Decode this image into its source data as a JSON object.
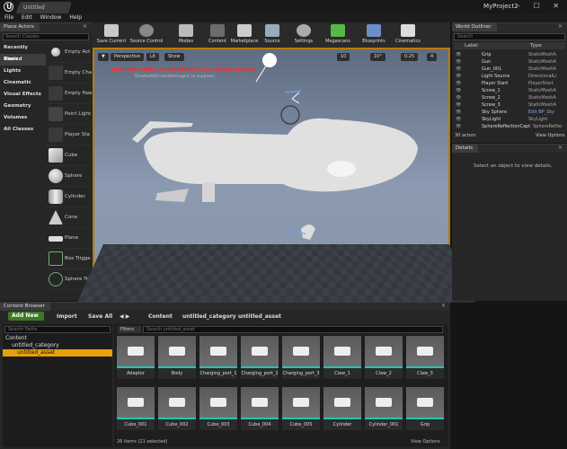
{
  "titlebar": {
    "tab": "Untitled",
    "project": "MyProject2",
    "controls": "– ☐ ✕"
  },
  "menu": [
    "File",
    "Edit",
    "Window",
    "Help"
  ],
  "place_actors": {
    "title": "Place Actors",
    "search_placeholder": "Search Classes",
    "categories": [
      "Recently Placed",
      "Basic",
      "Lights",
      "Cinematic",
      "Visual Effects",
      "Geometry",
      "Volumes",
      "All Classes"
    ],
    "items": [
      "Empty Act",
      "Empty Cha",
      "Empty Paw",
      "Point Light",
      "Player Sta",
      "Cube",
      "Sphere",
      "Cylinder",
      "Cone",
      "Plane",
      "Box Trigge",
      "Sphere Tri"
    ]
  },
  "toolbar": [
    "Save Current",
    "Source Control",
    "Modes",
    "Content",
    "Marketplace",
    "Source",
    "Settings",
    "Megascans",
    "Blueprints",
    "Cinematics"
  ],
  "viewport": {
    "perspective": "Perspective",
    "lit": "Lit",
    "show": "Show",
    "snap_grid": "10",
    "snap_rot": "10°",
    "snap_scale": "0.25",
    "cam_speed": "4",
    "warning": "LIGHTING NEEDS TO BE REBUILT (31 unbuilt objects)",
    "warning_sub": "'DisableAllScreenMessages' to suppress"
  },
  "world_outliner": {
    "title": "World Outliner",
    "search_placeholder": "Search",
    "col_label": "Label",
    "col_type": "Type",
    "rows": [
      {
        "name": "Grip",
        "type": "StaticMeshA"
      },
      {
        "name": "Gun",
        "type": "StaticMeshA"
      },
      {
        "name": "Gun_001",
        "type": "StaticMeshA"
      },
      {
        "name": "Light Source",
        "type": "DirectionalLi"
      },
      {
        "name": "Player Start",
        "type": "PlayerStart"
      },
      {
        "name": "Screw_1",
        "type": "StaticMeshA"
      },
      {
        "name": "Screw_2",
        "type": "StaticMeshA"
      },
      {
        "name": "Screw_3",
        "type": "StaticMeshA"
      },
      {
        "name": "Sky Sphere",
        "type": "Edit BP_Sky"
      },
      {
        "name": "SkyLight",
        "type": "SkyLight"
      },
      {
        "name": "SphereReflectionCapt",
        "type": "SphereReflec"
      }
    ],
    "count": "30 actors",
    "view_options": "View Options"
  },
  "details": {
    "title": "Details",
    "empty_msg": "Select an object to view details."
  },
  "content_browser": {
    "title": "Content Browser",
    "add_new": "Add New",
    "import": "Import",
    "save_all": "Save All",
    "breadcrumb": [
      "Content",
      "untitled_category",
      "untitled_asset"
    ],
    "search_paths": "Search Paths",
    "filters": "Filters",
    "search_asset": "Search untitled_asset",
    "tree": [
      "Content",
      "untitled_category",
      "untitled_asset"
    ],
    "assets_row1": [
      "Adaptor",
      "Body",
      "Charging_port_1",
      "Charging_port_2",
      "Charging_port_3",
      "Claw_1",
      "Claw_2",
      "Claw_3"
    ],
    "assets_row2": [
      "Cube_001",
      "Cube_002",
      "Cube_003",
      "Cube_004",
      "Cube_005",
      "Cylinder",
      "Cylinder_001",
      "Grip"
    ],
    "status": "26 items (21 selected)",
    "view_options": "View Options"
  }
}
